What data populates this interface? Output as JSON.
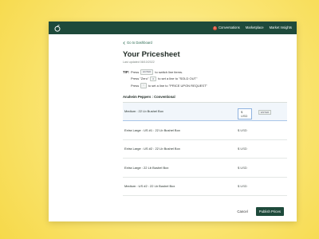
{
  "nav": {
    "conversations_badge": "1",
    "conversations": "Conversations",
    "marketplace": "Marketplace",
    "market_insights": "Market Insights"
  },
  "page": {
    "back_link": "Go to Dashboard",
    "title": "Your Pricesheet",
    "last_updated": "Last updated 08/10/2022"
  },
  "tip": {
    "label": "TIP:",
    "line1": {
      "prefix": "Press",
      "key": "ENTER",
      "suffix": "to switch line items."
    },
    "line2": {
      "prefix": "Press \"Zero\"",
      "key": "0",
      "suffix": "to set a line to \"SOLD OUT\""
    },
    "line3": {
      "prefix": "Press",
      "key": "↑",
      "suffix": "to set a line to \"PRICE UPON REQUEST\""
    }
  },
  "section_title": "Anaheim Peppers : Conventional",
  "rows": [
    {
      "label": "Medium : 22 Lb Bushel Box",
      "price": "$ USD",
      "hint": "ENTER"
    },
    {
      "label": "Extra Large : US #1 : 22 Lb Bushel Box",
      "price": "$ USD"
    },
    {
      "label": "Extra Large : US #2 : 22 Lb Bushel Box",
      "price": "$ USD"
    },
    {
      "label": "Extra Large : 22 Lb Bushel Box",
      "price": "$ USD"
    },
    {
      "label": "Medium : US #2 : 22 Lb Bushel Box",
      "price": "$ USD"
    }
  ],
  "footer": {
    "cancel": "Cancel",
    "publish": "Publish Prices"
  }
}
